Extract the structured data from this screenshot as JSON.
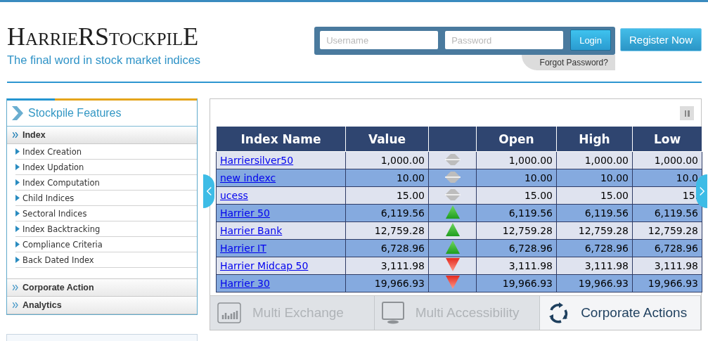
{
  "logo": {
    "pieces": [
      {
        "text": "H",
        "kind": "big"
      },
      {
        "text": "ARRIE",
        "kind": "small"
      },
      {
        "text": "R",
        "kind": "big"
      },
      {
        "text": "S",
        "kind": "big"
      },
      {
        "text": "TOCKPIL",
        "kind": "small"
      },
      {
        "text": "E",
        "kind": "big"
      }
    ],
    "tagline": "The final word in stock market indices"
  },
  "login": {
    "username": {
      "placeholder": "Username"
    },
    "password": {
      "placeholder": "Password"
    },
    "button": "Login",
    "forgot": "Forgot Password?",
    "register": "Register Now"
  },
  "sidebar": {
    "title": "Stockpile Features",
    "sections": [
      {
        "label": "Index",
        "expanded": true,
        "children": [
          "Index Creation",
          "Index Updation",
          "Index Computation",
          "Child Indices",
          "Sectoral Indices",
          "Index Backtracking",
          "Compliance Criteria",
          "Back Dated Index"
        ]
      },
      {
        "label": "Corporate Action",
        "expanded": false
      },
      {
        "label": "Analytics",
        "expanded": false
      }
    ]
  },
  "table": {
    "columns": [
      "Index Name",
      "Value",
      "",
      "Open",
      "High",
      "Low"
    ],
    "rows": [
      {
        "name": "Harriersilver50",
        "value": "1,000.00",
        "kind": "flat",
        "open": "1,000.00",
        "high": "1,000.00",
        "low": "1,000.00"
      },
      {
        "name": "new indexc",
        "value": "10.00",
        "kind": "flat",
        "open": "10.00",
        "high": "10.00",
        "low": "10.0"
      },
      {
        "name": "ucess",
        "value": "15.00",
        "kind": "flat",
        "open": "15.00",
        "high": "15.00",
        "low": "15."
      },
      {
        "name": "Harrier 50",
        "value": "6,119.56",
        "kind": "up",
        "open": "6,119.56",
        "high": "6,119.56",
        "low": "6,119.56"
      },
      {
        "name": "Harrier Bank",
        "value": "12,759.28",
        "kind": "up",
        "open": "12,759.28",
        "high": "12,759.28",
        "low": "12,759.28"
      },
      {
        "name": "Harrier IT",
        "value": "6,728.96",
        "kind": "up",
        "open": "6,728.96",
        "high": "6,728.96",
        "low": "6,728.96"
      },
      {
        "name": "Harrier Midcap 50",
        "value": "3,111.98",
        "kind": "down",
        "open": "3,111.98",
        "high": "3,111.98",
        "low": "3,111.98"
      },
      {
        "name": "Harrier 30",
        "value": "19,966.93",
        "kind": "down",
        "open": "19,966.93",
        "high": "19,966.93",
        "low": "19,966.93"
      }
    ]
  },
  "features": [
    {
      "label": "Multi Exchange",
      "kind": "chart",
      "selected": false
    },
    {
      "label": "Multi Accessibility",
      "kind": "monitor",
      "selected": false
    },
    {
      "label": "Corporate Actions",
      "kind": "cycle",
      "selected": true
    }
  ]
}
